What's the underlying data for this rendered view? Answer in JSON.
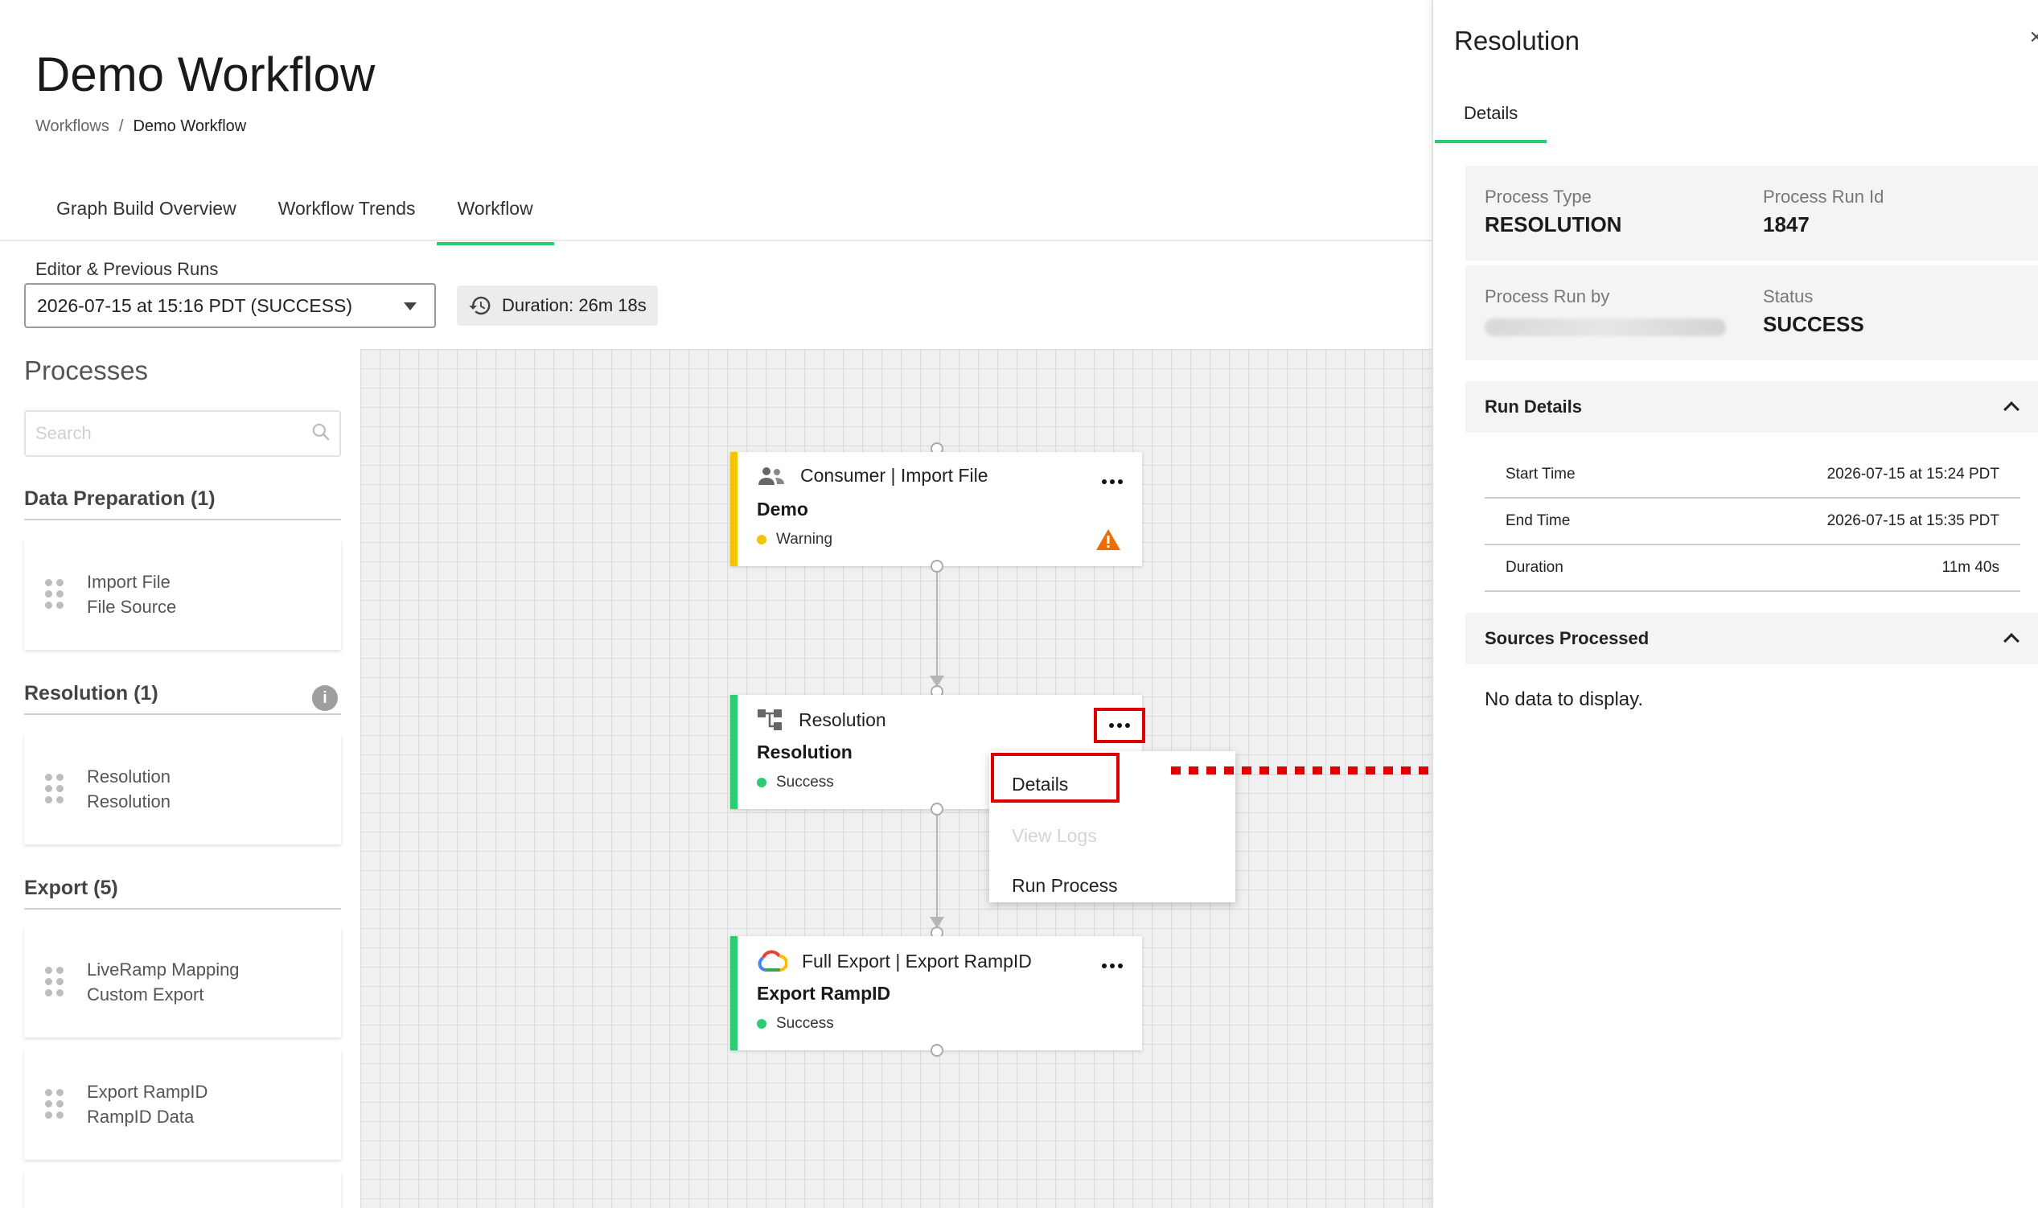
{
  "page": {
    "title": "Demo Workflow",
    "breadcrumb": {
      "root": "Workflows",
      "separator": "/",
      "current": "Demo Workflow"
    },
    "tabs": [
      {
        "label": "Graph Build Overview",
        "active": false
      },
      {
        "label": "Workflow Trends",
        "active": false
      },
      {
        "label": "Workflow",
        "active": true
      }
    ]
  },
  "runs": {
    "label": "Editor & Previous Runs",
    "selected": "2026-07-15 at 15:16 PDT (SUCCESS)",
    "duration": "Duration: 26m 18s"
  },
  "processes": {
    "title": "Processes",
    "search_placeholder": "Search",
    "sections": [
      {
        "header": "Data Preparation (1)",
        "items": [
          {
            "line1": "Import File",
            "line2": "File Source"
          }
        ]
      },
      {
        "header": "Resolution (1)",
        "items": [
          {
            "line1": "Resolution",
            "line2": "Resolution"
          }
        ]
      },
      {
        "header": "Export (5)",
        "items": [
          {
            "line1": "LiveRamp Mapping",
            "line2": "Custom Export"
          },
          {
            "line1": "Export RampID",
            "line2": "RampID Data"
          }
        ]
      }
    ]
  },
  "nodes": [
    {
      "type": "Consumer | Import File",
      "name": "Demo",
      "status": "Warning",
      "icon": "users-icon"
    },
    {
      "type": "Resolution",
      "name": "Resolution",
      "status": "Success",
      "icon": "hierarchy-icon"
    },
    {
      "type": "Full Export | Export RampID",
      "name": "Export RampID",
      "status": "Success",
      "icon": "google-cloud-icon"
    }
  ],
  "context_menu": {
    "items": [
      {
        "label": "Details",
        "enabled": true
      },
      {
        "label": "View Logs",
        "enabled": false
      },
      {
        "label": "Run Process",
        "enabled": true
      }
    ]
  },
  "panel": {
    "title": "Resolution",
    "tab": "Details",
    "process_type_label": "Process Type",
    "process_type": "RESOLUTION",
    "run_id_label": "Process Run Id",
    "run_id": "1847",
    "run_by_label": "Process Run by",
    "status_label": "Status",
    "status": "SUCCESS",
    "run_details": {
      "header": "Run Details",
      "rows": [
        {
          "label": "Start Time",
          "value": "2026-07-15 at 15:24 PDT"
        },
        {
          "label": "End Time",
          "value": "2026-07-15 at 15:35 PDT"
        },
        {
          "label": "Duration",
          "value": "11m 40s"
        }
      ]
    },
    "sources": {
      "header": "Sources Processed",
      "empty_text": "No data to display."
    }
  },
  "colors": {
    "accent": "#2ecc71",
    "warning": "#f5c400",
    "highlight": "#e00000"
  }
}
